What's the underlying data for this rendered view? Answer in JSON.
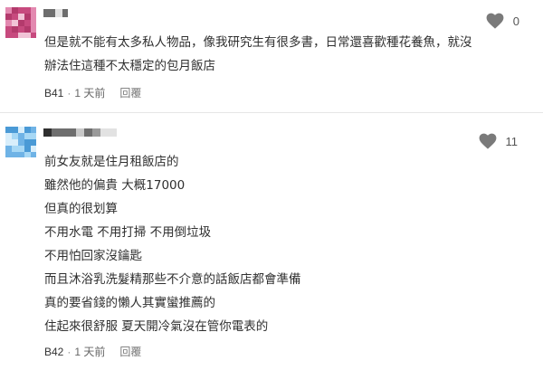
{
  "comments": [
    {
      "likes": "0",
      "lines": [
        "但是就不能有太多私人物品，像我研究生有很多書，日常還喜歡種花養魚，就沒",
        "辦法住這種不太穩定的包月飯店"
      ],
      "floor": "B41",
      "separator": "·",
      "time": "1 天前",
      "reply_label": "回覆"
    },
    {
      "likes": "11",
      "lines": [
        "前女友就是住月租飯店的",
        "雖然他的偏貴 大概17000",
        "但真的很划算",
        "不用水電 不用打掃 不用倒垃圾",
        "不用怕回家沒鑰匙",
        "而且沐浴乳洗髮精那些不介意的話飯店都會準備",
        "真的要省錢的懶人其實蠻推薦的",
        "住起來很舒服 夏天開冷氣沒在管你電表的"
      ],
      "floor": "B42",
      "separator": "·",
      "time": "1 天前",
      "reply_label": "回覆"
    }
  ],
  "colors": {
    "avatar1": [
      "#c74a7e",
      "#e389b0",
      "#b33a6c",
      "#f1c3d6"
    ],
    "avatar2": [
      "#6fb3e6",
      "#a7d8f5",
      "#4a9ad6",
      "#d8eefb"
    ],
    "heart": "#7a7a7a"
  },
  "icons": {
    "like": "heart-icon"
  }
}
